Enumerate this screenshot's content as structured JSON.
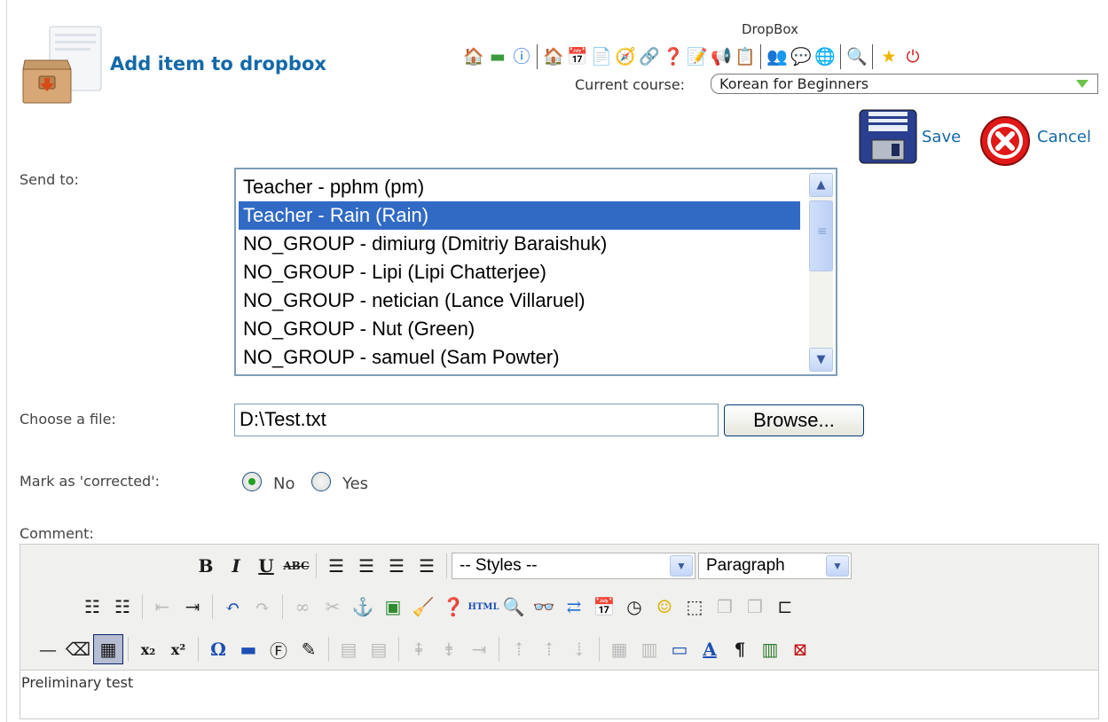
{
  "header": {
    "title": "Add item to dropbox",
    "tool_title": "DropBox",
    "course_label": "Current course:",
    "course_value": "Korean for Beginners",
    "save_label": "Save",
    "cancel_label": "Cancel",
    "tool_icons": [
      "homepage-icon",
      "course-description-icon",
      "introduction-icon",
      "course-homepage-icon",
      "agenda-icon",
      "documents-icon",
      "learning-path-icon",
      "links-icon",
      "help-icon",
      "exercises-icon",
      "announcements-icon",
      "forum-icon",
      "users-icon",
      "chat-icon",
      "wiki-icon",
      "search-icon",
      "favorite-icon",
      "logout-icon"
    ]
  },
  "form": {
    "send_to_label": "Send to:",
    "recipients": [
      "Teacher - pphm (pm)",
      "Teacher - Rain (Rain)",
      "NO_GROUP - dimiurg (Dmitriy Baraishuk)",
      "NO_GROUP - Lipi (Lipi Chatterjee)",
      "NO_GROUP - netician (Lance Villaruel)",
      "NO_GROUP - Nut (Green)",
      "NO_GROUP - samuel (Sam Powter)"
    ],
    "selected_recipient": "Teacher - Rain (Rain)",
    "file_label": "Choose a file:",
    "file_value": "D:\\Test.txt",
    "browse_label": "Browse...",
    "corrected_label": "Mark as 'corrected':",
    "corrected_no": "No",
    "corrected_yes": "Yes",
    "corrected_selected": "No",
    "comment_label": "Comment:"
  },
  "editor": {
    "styles_value": "-- Styles --",
    "format_value": "Paragraph",
    "content": "Preliminary test",
    "accent_color": "#316ac5"
  }
}
